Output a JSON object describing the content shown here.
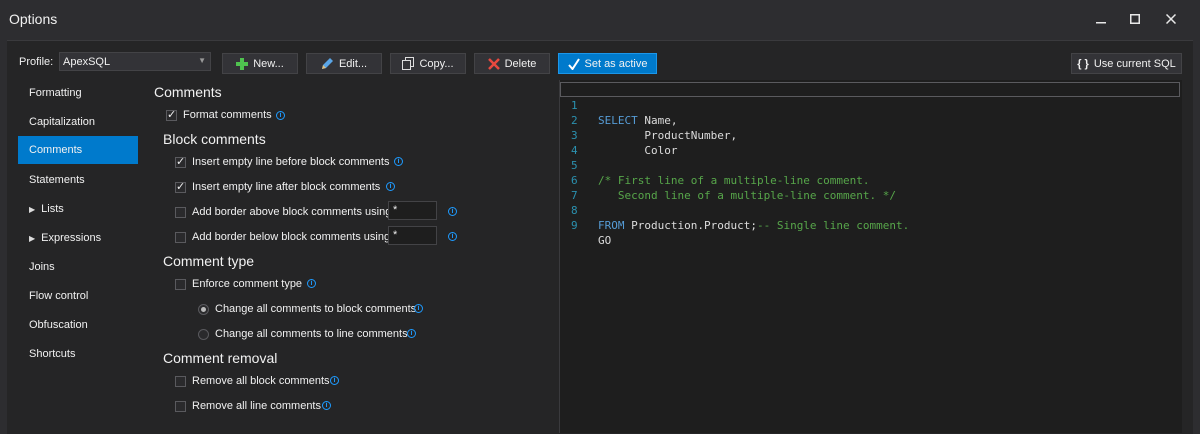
{
  "window": {
    "title": "Options"
  },
  "profile": {
    "label": "Profile:",
    "value": "ApexSQL"
  },
  "toolbar": {
    "new_label": "New...",
    "edit_label": "Edit...",
    "copy_label": "Copy...",
    "delete_label": "Delete",
    "set_active_label": "Set as active",
    "use_current_label": "Use current SQL"
  },
  "nav": {
    "items": [
      {
        "label": "Formatting"
      },
      {
        "label": "Capitalization"
      },
      {
        "label": "Comments"
      },
      {
        "label": "Statements"
      },
      {
        "label": "Lists"
      },
      {
        "label": "Expressions"
      },
      {
        "label": "Joins"
      },
      {
        "label": "Flow control"
      },
      {
        "label": "Obfuscation"
      },
      {
        "label": "Shortcuts"
      }
    ]
  },
  "main": {
    "comments_title": "Comments",
    "format_comments": "Format comments",
    "block_title": "Block comments",
    "insert_before": "Insert empty line before block comments",
    "insert_after": "Insert empty line after block comments",
    "border_above": "Add border above block comments using",
    "border_above_value": "*",
    "border_below": "Add border below block comments using",
    "border_below_value": "*",
    "type_title": "Comment type",
    "enforce_type": "Enforce comment type",
    "to_block": "Change all comments to block comments",
    "to_line": "Change all comments to line comments",
    "removal_title": "Comment removal",
    "remove_block": "Remove all block comments",
    "remove_line": "Remove all line comments"
  },
  "editor": {
    "lines": [
      {
        "num": "1",
        "kw": "SELECT",
        "rest": " Name,"
      },
      {
        "num": "2",
        "text": "       ProductNumber,"
      },
      {
        "num": "3",
        "text": "       Color"
      },
      {
        "num": "4",
        "text": ""
      },
      {
        "num": "5",
        "comment": "/* First line of a multiple-line comment."
      },
      {
        "num": "6",
        "comment": "   Second line of a multiple-line comment. */"
      },
      {
        "num": "7",
        "text": ""
      },
      {
        "num": "8",
        "kw": "FROM",
        "rest": " Production.Product;",
        "comment": "-- Single line comment."
      },
      {
        "num": "9",
        "text": "GO"
      }
    ]
  },
  "colors": {
    "accent": "#007acc",
    "keyword": "#569cd6",
    "comment": "#57a64a",
    "line_number": "#2b91af"
  }
}
